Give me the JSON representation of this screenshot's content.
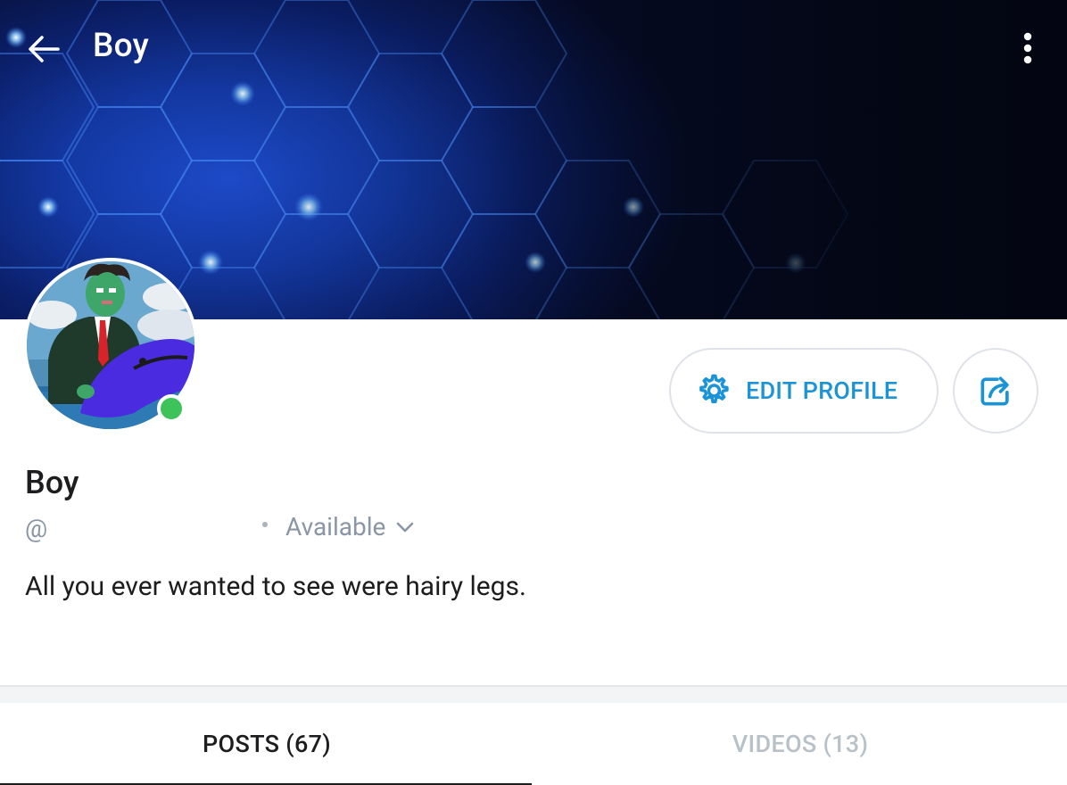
{
  "header": {
    "title": "Boy",
    "back_icon": "arrow-left-icon",
    "more_icon": "more-vertical-icon"
  },
  "profile": {
    "display_name": "Boy",
    "handle": "@",
    "status": "Available",
    "bio": "All you ever wanted to see were hairy legs.",
    "online": true
  },
  "actions": {
    "edit_profile_label": "EDIT PROFILE",
    "edit_icon": "gear-icon",
    "share_icon": "share-icon"
  },
  "tabs": [
    {
      "label": "POSTS (67)",
      "active": true
    },
    {
      "label": "VIDEOS (13)",
      "active": false
    }
  ],
  "colors": {
    "accent": "#1a94d6",
    "online": "#3ec35a",
    "muted": "#8a96a3"
  }
}
